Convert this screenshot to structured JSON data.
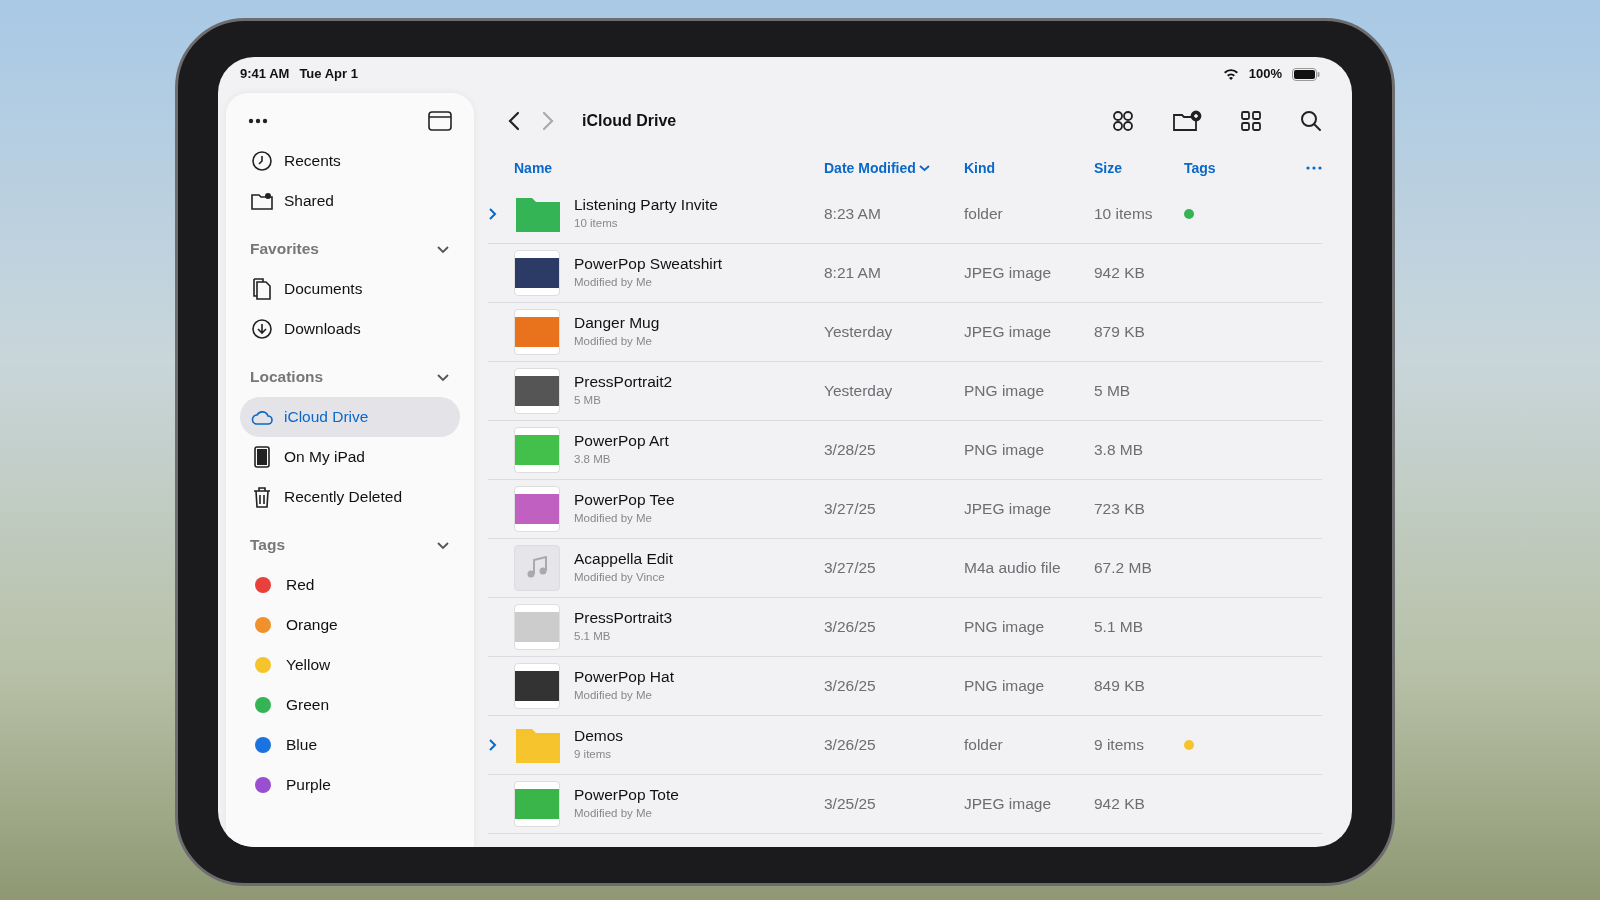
{
  "status_bar": {
    "time": "9:41 AM",
    "date": "Tue Apr 1",
    "battery": "100%"
  },
  "toolbar": {
    "title": "iCloud Drive"
  },
  "sidebar": {
    "sections": [
      {
        "items": [
          {
            "kind": "recents",
            "label": "Recents",
            "selected": false
          },
          {
            "kind": "shared",
            "label": "Shared",
            "selected": false
          }
        ]
      },
      {
        "title": "Favorites",
        "expanded": true,
        "items": [
          {
            "kind": "documents",
            "label": "Documents",
            "selected": false
          },
          {
            "kind": "downloads",
            "label": "Downloads",
            "selected": false
          }
        ]
      },
      {
        "title": "Locations",
        "expanded": true,
        "items": [
          {
            "kind": "cloud",
            "label": "iCloud Drive",
            "selected": true
          },
          {
            "kind": "ipad",
            "label": "On My iPad",
            "selected": false
          },
          {
            "kind": "trash",
            "label": "Recently Deleted",
            "selected": false
          }
        ]
      },
      {
        "title": "Tags",
        "expanded": true,
        "items": [
          {
            "kind": "tag",
            "label": "Red",
            "color": "#e8413c",
            "selected": false
          },
          {
            "kind": "tag",
            "label": "Orange",
            "color": "#f0912b",
            "selected": false
          },
          {
            "kind": "tag",
            "label": "Yellow",
            "color": "#f5c42c",
            "selected": false
          },
          {
            "kind": "tag",
            "label": "Green",
            "color": "#35b456",
            "selected": false
          },
          {
            "kind": "tag",
            "label": "Blue",
            "color": "#1a73e0",
            "selected": false
          },
          {
            "kind": "tag",
            "label": "Purple",
            "color": "#9a4fd0",
            "selected": false
          }
        ]
      }
    ]
  },
  "table": {
    "columns": [
      {
        "label": "Name",
        "sorted": false
      },
      {
        "label": "Date Modified",
        "sorted": true
      },
      {
        "label": "Kind",
        "sorted": false
      },
      {
        "label": "Size",
        "sorted": false
      },
      {
        "label": "Tags",
        "sorted": false
      }
    ],
    "rows": [
      {
        "kind": "folder",
        "expanded": false,
        "name": "Listening Party Invite",
        "sub": "10 items",
        "date": "8:23 AM",
        "type": "folder",
        "size": "10 items",
        "color": "#35b456"
      },
      {
        "kind": "image",
        "name": "PowerPop Sweatshirt",
        "sub": "Modified by Me",
        "date": "8:21 AM",
        "type": "JPEG image",
        "size": "942 KB"
      },
      {
        "kind": "image",
        "name": "Danger Mug",
        "sub": "Modified by Me",
        "date": "Yesterday",
        "type": "JPEG image",
        "size": "879 KB"
      },
      {
        "kind": "image",
        "name": "PressPortrait2",
        "sub": "5 MB",
        "date": "Yesterday",
        "type": "PNG image",
        "size": "5 MB"
      },
      {
        "kind": "image",
        "name": "PowerPop Art",
        "sub": "3.8 MB",
        "date": "3/28/25",
        "type": "PNG image",
        "size": "3.8 MB"
      },
      {
        "kind": "image",
        "name": "PowerPop Tee",
        "sub": "Modified by Me",
        "date": "3/27/25",
        "type": "JPEG image",
        "size": "723 KB"
      },
      {
        "kind": "audio",
        "name": "Acappella Edit",
        "sub": "Modified by Vince",
        "date": "3/27/25",
        "type": "M4a audio file",
        "size": "67.2 MB"
      },
      {
        "kind": "image",
        "name": "PressPortrait3",
        "sub": "5.1 MB",
        "date": "3/26/25",
        "type": "PNG image",
        "size": "5.1 MB"
      },
      {
        "kind": "image",
        "name": "PowerPop Hat",
        "sub": "Modified by Me",
        "date": "3/26/25",
        "type": "PNG image",
        "size": "849 KB"
      },
      {
        "kind": "folder",
        "expanded": false,
        "name": "Demos",
        "sub": "9 items",
        "date": "3/26/25",
        "type": "folder",
        "size": "9 items",
        "color": "#f5c42c"
      },
      {
        "kind": "image",
        "name": "PowerPop Tote",
        "sub": "Modified by Me",
        "date": "3/25/25",
        "type": "JPEG image",
        "size": "942 KB"
      }
    ]
  }
}
